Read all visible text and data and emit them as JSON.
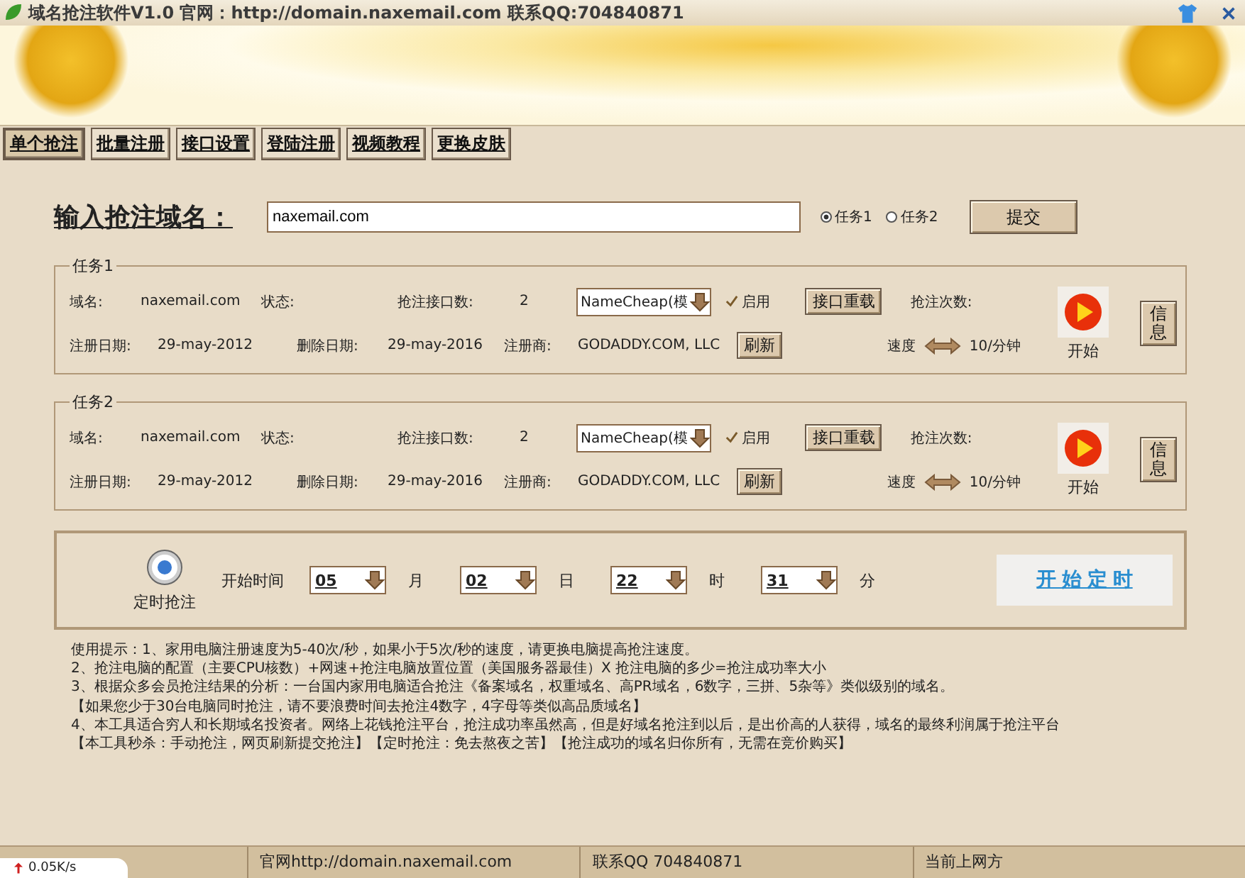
{
  "window": {
    "title": "域名抢注软件V1.0 官网：http://domain.naxemail.com 联系QQ:704840871"
  },
  "tabs": [
    {
      "label": "单个抢注",
      "selected": true
    },
    {
      "label": "批量注册",
      "selected": false
    },
    {
      "label": "接口设置",
      "selected": false
    },
    {
      "label": "登陆注册",
      "selected": false
    },
    {
      "label": "视频教程",
      "selected": false
    },
    {
      "label": "更换皮肤",
      "selected": false
    }
  ],
  "domain_input": {
    "label": "输入抢注域名：",
    "value": "naxemail.com"
  },
  "task_radios": [
    {
      "label": "任务1",
      "selected": true
    },
    {
      "label": "任务2",
      "selected": false
    }
  ],
  "submit_button": "提交",
  "tasks": [
    {
      "title": "任务1",
      "domain_label": "域名:",
      "domain": "naxemail.com",
      "status_label": "状态:",
      "interfaces_label": "抢注接口数:",
      "interfaces": "2",
      "registrar_select": "NameCheap(模",
      "enabled": {
        "label": "启用",
        "checked": true
      },
      "reload_button": "接口重载",
      "count_label": "抢注次数:",
      "reg_date_label": "注册日期:",
      "reg_date": "29-may-2012",
      "del_date_label": "删除日期:",
      "del_date": "29-may-2016",
      "registrar_label": "注册商:",
      "registrar": "GODADDY.COM, LLC",
      "refresh_button": "刷新",
      "speed_label": "速度",
      "speed": "10/分钟",
      "start_label": "开始",
      "info_button": "信息"
    },
    {
      "title": "任务2",
      "domain_label": "域名:",
      "domain": "naxemail.com",
      "status_label": "状态:",
      "interfaces_label": "抢注接口数:",
      "interfaces": "2",
      "registrar_select": "NameCheap(模",
      "enabled": {
        "label": "启用",
        "checked": true
      },
      "reload_button": "接口重载",
      "count_label": "抢注次数:",
      "reg_date_label": "注册日期:",
      "reg_date": "29-may-2012",
      "del_date_label": "删除日期:",
      "del_date": "29-may-2016",
      "registrar_label": "注册商:",
      "registrar": "GODADDY.COM, LLC",
      "refresh_button": "刷新",
      "speed_label": "速度",
      "speed": "10/分钟",
      "start_label": "开始",
      "info_button": "信息"
    }
  ],
  "timer": {
    "label": "定时抢注",
    "start_time_label": "开始时间",
    "fields": [
      {
        "value": "05",
        "unit": "月"
      },
      {
        "value": "02",
        "unit": "日"
      },
      {
        "value": "22",
        "unit": "时"
      },
      {
        "value": "31",
        "unit": "分"
      }
    ],
    "start_button": "开 始 定 时"
  },
  "tips": [
    "使用提示：1、家用电脑注册速度为5-40次/秒，如果小于5次/秒的速度，请更换电脑提高抢注速度。",
    "2、抢注电脑的配置（主要CPU核数）+网速+抢注电脑放置位置（美国服务器最佳）X 抢注电脑的多少=抢注成功率大小",
    "3、根据众多会员抢注结果的分析：一台国内家用电脑适合抢注《备案域名，权重域名、高PR域名，6数字，三拼、5杂等》类似级别的域名。",
    "【如果您少于30台电脑同时抢注，请不要浪费时间去抢注4数字，4字母等类似高品质域名】",
    "4、本工具适合穷人和长期域名投资者。网络上花钱抢注平台，抢注成功率虽然高，但是好域名抢注到以后，是出价高的人获得，域名的最终利润属于抢注平台",
    "【本工具秒杀：手动抢注，网页刷新提交抢注】【定时抢注：免去熬夜之苦】【抢注成功的域名归你所有，无需在竞价购买】"
  ],
  "status_bar": [
    "官网http://domain.naxemail.com",
    "联系QQ 704840871",
    "当前上网方"
  ],
  "net_speed": "0.05K/s"
}
